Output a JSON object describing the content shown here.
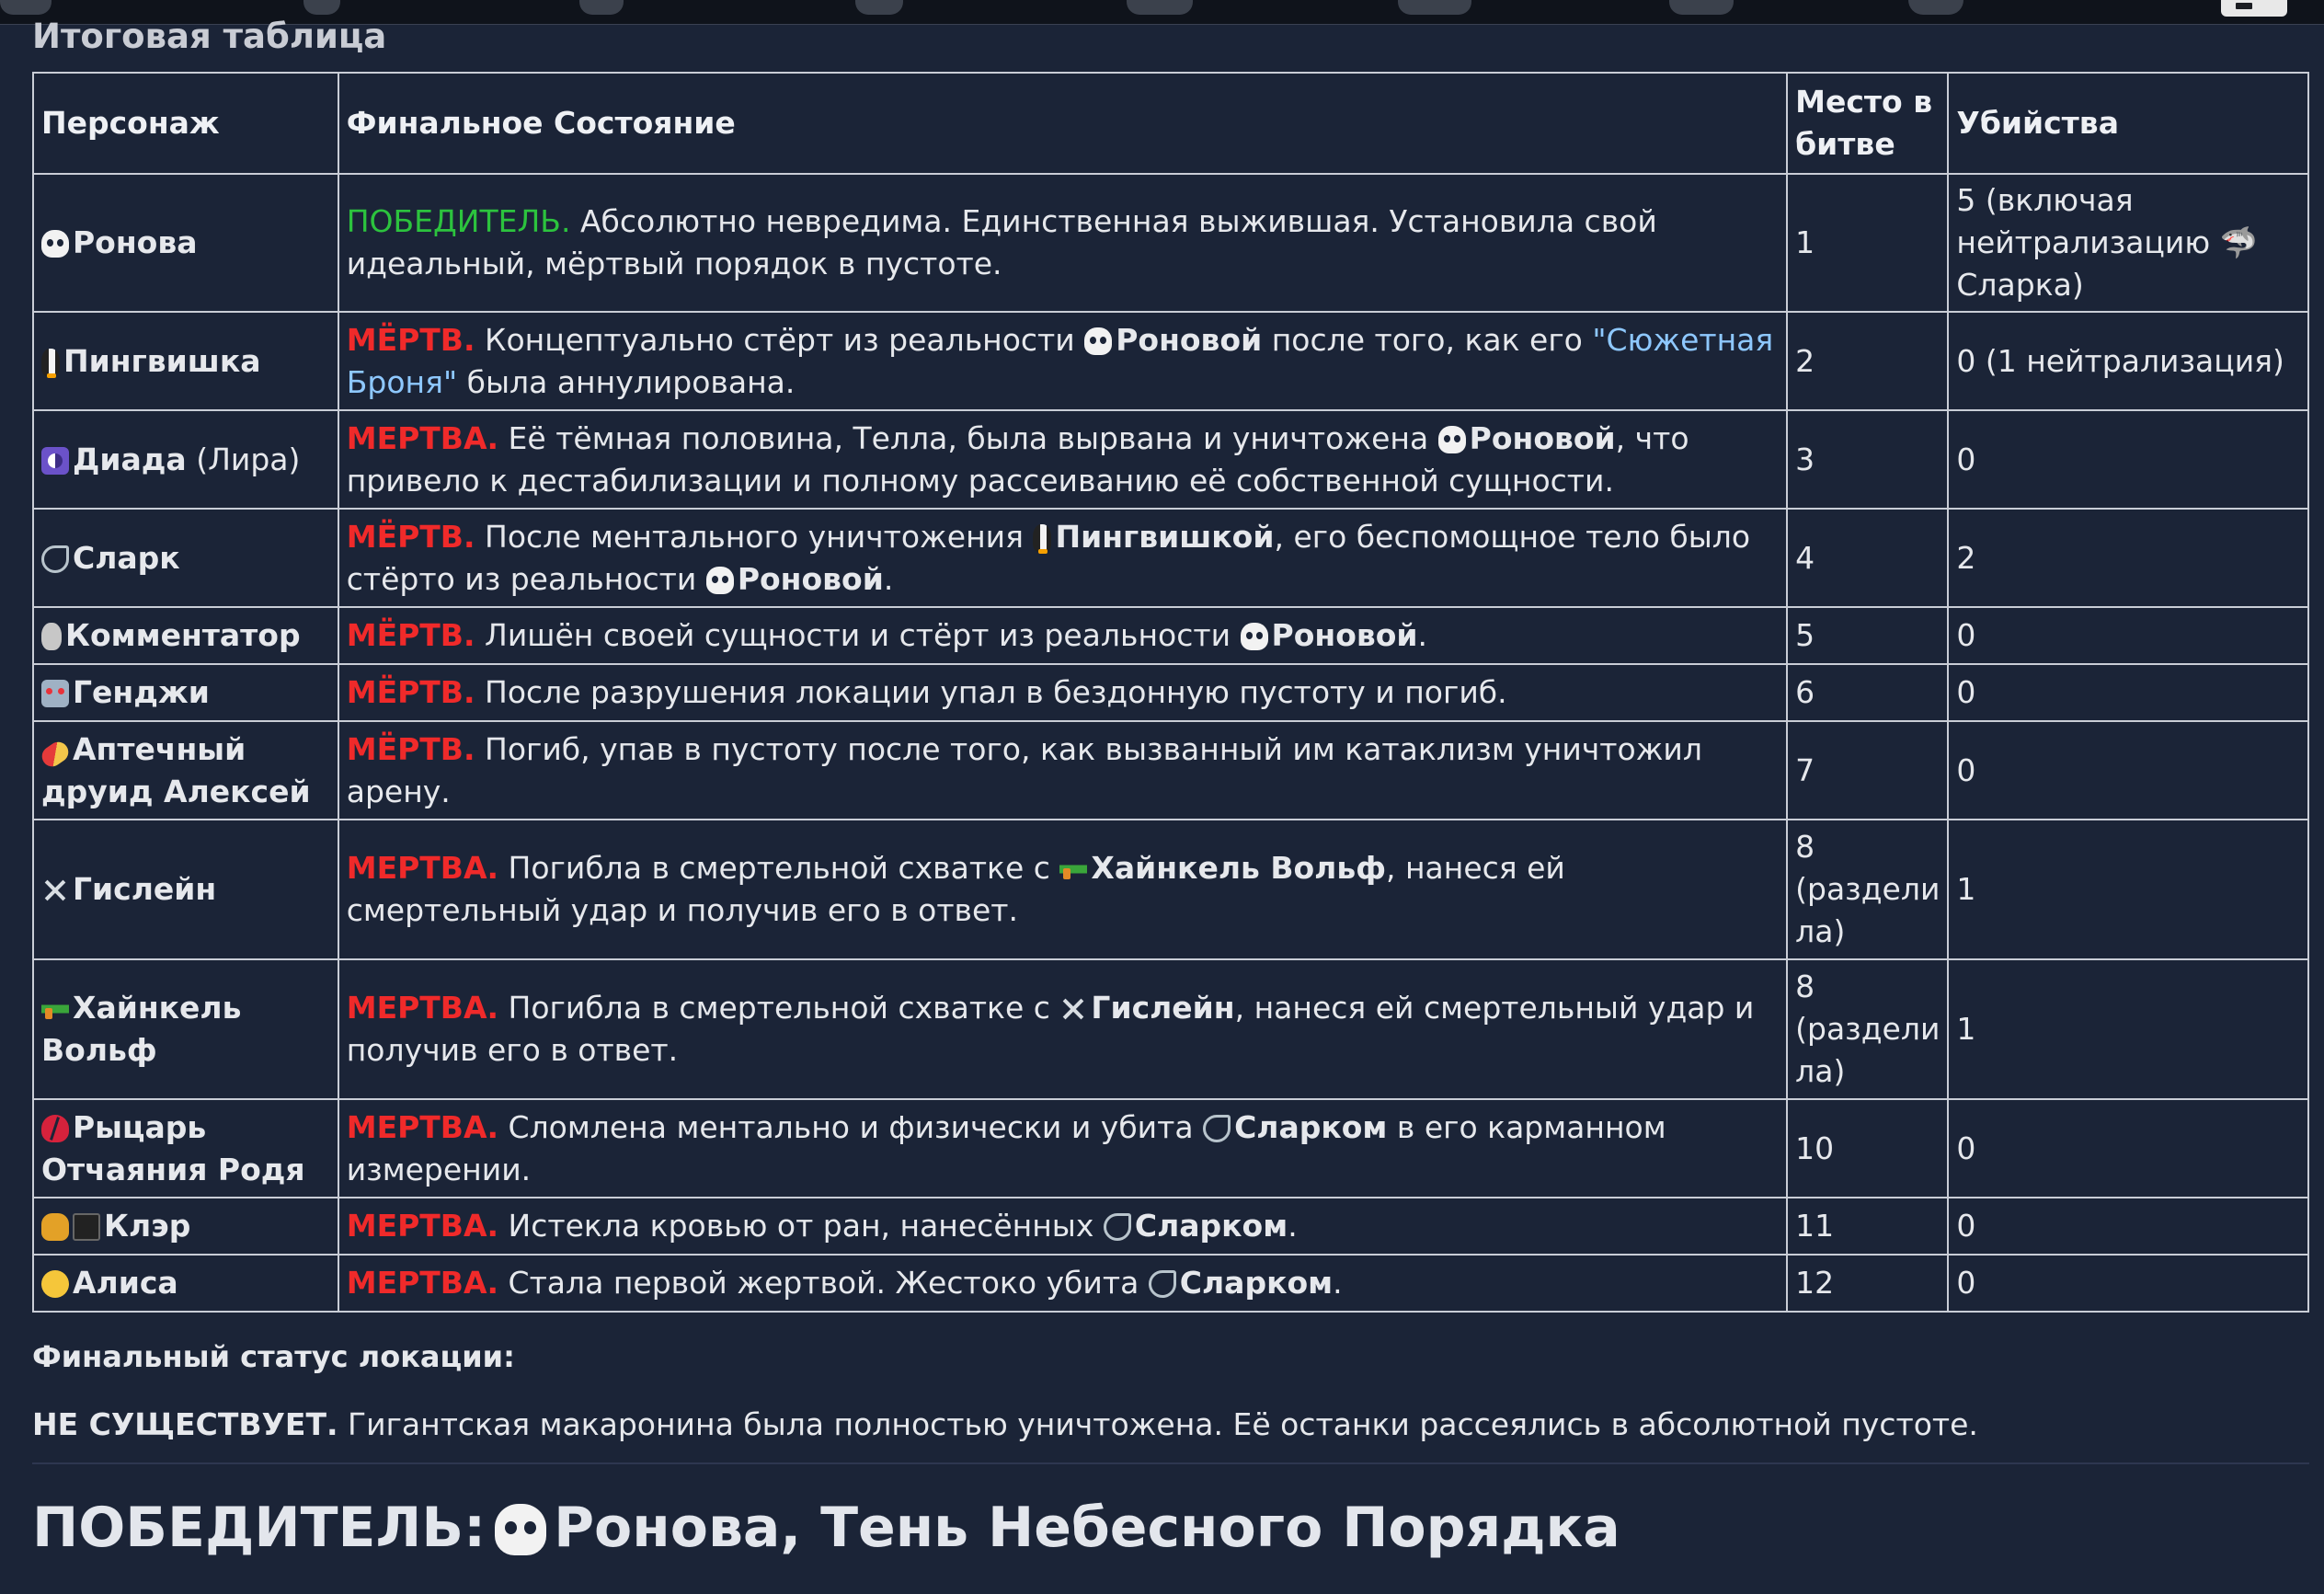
{
  "section_title": "Итоговая таблица",
  "table": {
    "headers": [
      "Персонаж",
      "Финальное Состояние",
      "Место в битве",
      "Убийства"
    ],
    "rows": [
      {
        "icon": "skull-icon",
        "name": "Ронова",
        "name_extra": "",
        "status": "ПОБЕДИТЕЛЬ.",
        "status_type": "win",
        "parts": [
          {
            "t": "Абсолютно невредима. Единственная выжившая. Установила свой идеальный, мёртвый порядок в пустоте.",
            "s": "plain"
          }
        ],
        "place": "1",
        "kills": "5 (включая нейтрализацию 🦈 Сларка)"
      },
      {
        "icon": "penguin-icon",
        "name": "Пингвишка",
        "name_extra": "",
        "status": "МЁРТВ.",
        "status_type": "dead",
        "parts": [
          {
            "t": "Концептуально стёрт из реальности ",
            "s": "plain"
          },
          {
            "t": "skull",
            "s": "emo"
          },
          {
            "t": "Роновой",
            "s": "bold"
          },
          {
            "t": " после того, как его ",
            "s": "plain"
          },
          {
            "t": "\"Сюжетная Броня\"",
            "s": "link"
          },
          {
            "t": " была аннулирована.",
            "s": "plain"
          }
        ],
        "place": "2",
        "kills": "0 (1 нейтрализация)"
      },
      {
        "icon": "yinyang-icon",
        "name": "Диада",
        "name_extra": " (Лира)",
        "status": "МЕРТВА.",
        "status_type": "dead",
        "parts": [
          {
            "t": "Её тёмная половина, Телла, была вырвана и уничтожена ",
            "s": "plain"
          },
          {
            "t": "skull",
            "s": "emo"
          },
          {
            "t": "Роновой",
            "s": "bold"
          },
          {
            "t": ", что привело к дестабилизации и полному рассеиванию её собственной сущности.",
            "s": "plain"
          }
        ],
        "place": "3",
        "kills": "0"
      },
      {
        "icon": "shark-icon",
        "name": "Сларк",
        "name_extra": "",
        "status": "МЁРТВ.",
        "status_type": "dead",
        "parts": [
          {
            "t": "После ментального уничтожения ",
            "s": "plain"
          },
          {
            "t": "penguin",
            "s": "emo"
          },
          {
            "t": "Пингвишкой",
            "s": "bold"
          },
          {
            "t": ", его беспомощное тело было стёрто из реальности ",
            "s": "plain"
          },
          {
            "t": "skull",
            "s": "emo"
          },
          {
            "t": "Роновой",
            "s": "bold"
          },
          {
            "t": ".",
            "s": "plain"
          }
        ],
        "place": "4",
        "kills": "2"
      },
      {
        "icon": "microphone-icon",
        "name": "Комментатор",
        "name_extra": "",
        "status": "МЁРТВ.",
        "status_type": "dead",
        "parts": [
          {
            "t": "Лишён своей сущности и стёрт из реальности ",
            "s": "plain"
          },
          {
            "t": "skull",
            "s": "emo"
          },
          {
            "t": "Роновой",
            "s": "bold"
          },
          {
            "t": ".",
            "s": "plain"
          }
        ],
        "place": "5",
        "kills": "0"
      },
      {
        "icon": "robot-icon",
        "name": "Генджи",
        "name_extra": "",
        "status": "МЁРТВ.",
        "status_type": "dead",
        "parts": [
          {
            "t": "После разрушения локации упал в бездонную пустоту и погиб.",
            "s": "plain"
          }
        ],
        "place": "6",
        "kills": "0"
      },
      {
        "icon": "pill-icon",
        "name": "Аптечный друид Алексей",
        "name_extra": "",
        "status": "МЁРТВ.",
        "status_type": "dead",
        "parts": [
          {
            "t": "Погиб, упав в пустоту после того, как вызванный им катаклизм уничтожил арену.",
            "s": "plain"
          }
        ],
        "place": "7",
        "kills": "0"
      },
      {
        "icon": "crossed-swords-icon",
        "name": "Гислейн",
        "name_extra": "",
        "status": "МЕРТВА.",
        "status_type": "dead",
        "parts": [
          {
            "t": "Погибла в смертельной схватке с ",
            "s": "plain"
          },
          {
            "t": "gun",
            "s": "emo"
          },
          {
            "t": "Хайнкель Вольф",
            "s": "bold"
          },
          {
            "t": ", нанеся ей смертельный удар и получив его в ответ.",
            "s": "plain"
          }
        ],
        "place": "8 (раздели ла)",
        "kills": "1"
      },
      {
        "icon": "water-gun-icon",
        "name": "Хайнкель Вольф",
        "name_extra": "",
        "status": "МЕРТВА.",
        "status_type": "dead",
        "parts": [
          {
            "t": "Погибла в смертельной схватке с ",
            "s": "plain"
          },
          {
            "t": "swords",
            "s": "emo"
          },
          {
            "t": "Гислейн",
            "s": "bold"
          },
          {
            "t": ", нанеся ей смертельный удар и получив его в ответ.",
            "s": "plain"
          }
        ],
        "place": "8 (раздели ла)",
        "kills": "1"
      },
      {
        "icon": "broken-heart-icon",
        "name": "Рыцарь Отчаяния Родя",
        "name_extra": "",
        "status": "МЕРТВА.",
        "status_type": "dead",
        "parts": [
          {
            "t": "Сломлена ментально и физически и убита ",
            "s": "plain"
          },
          {
            "t": "shark",
            "s": "emo"
          },
          {
            "t": "Сларком",
            "s": "bold"
          },
          {
            "t": " в его карманном измерении.",
            "s": "plain"
          }
        ],
        "place": "10",
        "kills": "0"
      },
      {
        "icon": "black-cat-icon",
        "name": "Клэр",
        "name_extra": "",
        "status": "МЕРТВА.",
        "status_type": "dead",
        "parts": [
          {
            "t": "Истекла кровью от ран, нанесённых ",
            "s": "plain"
          },
          {
            "t": "shark",
            "s": "emo"
          },
          {
            "t": "Сларком",
            "s": "bold"
          },
          {
            "t": ".",
            "s": "plain"
          }
        ],
        "place": "11",
        "kills": "0"
      },
      {
        "icon": "face-icon",
        "name": "Алиса",
        "name_extra": "",
        "status": "МЕРТВА.",
        "status_type": "dead",
        "parts": [
          {
            "t": "Стала первой жертвой. Жестоко убита ",
            "s": "plain"
          },
          {
            "t": "shark",
            "s": "emo"
          },
          {
            "t": "Сларком",
            "s": "bold"
          },
          {
            "t": ".",
            "s": "plain"
          }
        ],
        "place": "12",
        "kills": "0"
      }
    ]
  },
  "location": {
    "label": "Финальный статус локации:",
    "status": "НЕ СУЩЕСТВУЕТ.",
    "text": " Гигантская макаронина была полностью уничтожена. Её останки рассеялись в абсолютной пустоте."
  },
  "winner": {
    "prefix": "ПОБЕДИТЕЛЬ:",
    "name": "Ронова, Тень Небесного Порядка"
  },
  "colors": {
    "background": "#1b2437",
    "win": "#2cc33e",
    "dead": "#f02a2a",
    "link": "#8ec8ff"
  }
}
